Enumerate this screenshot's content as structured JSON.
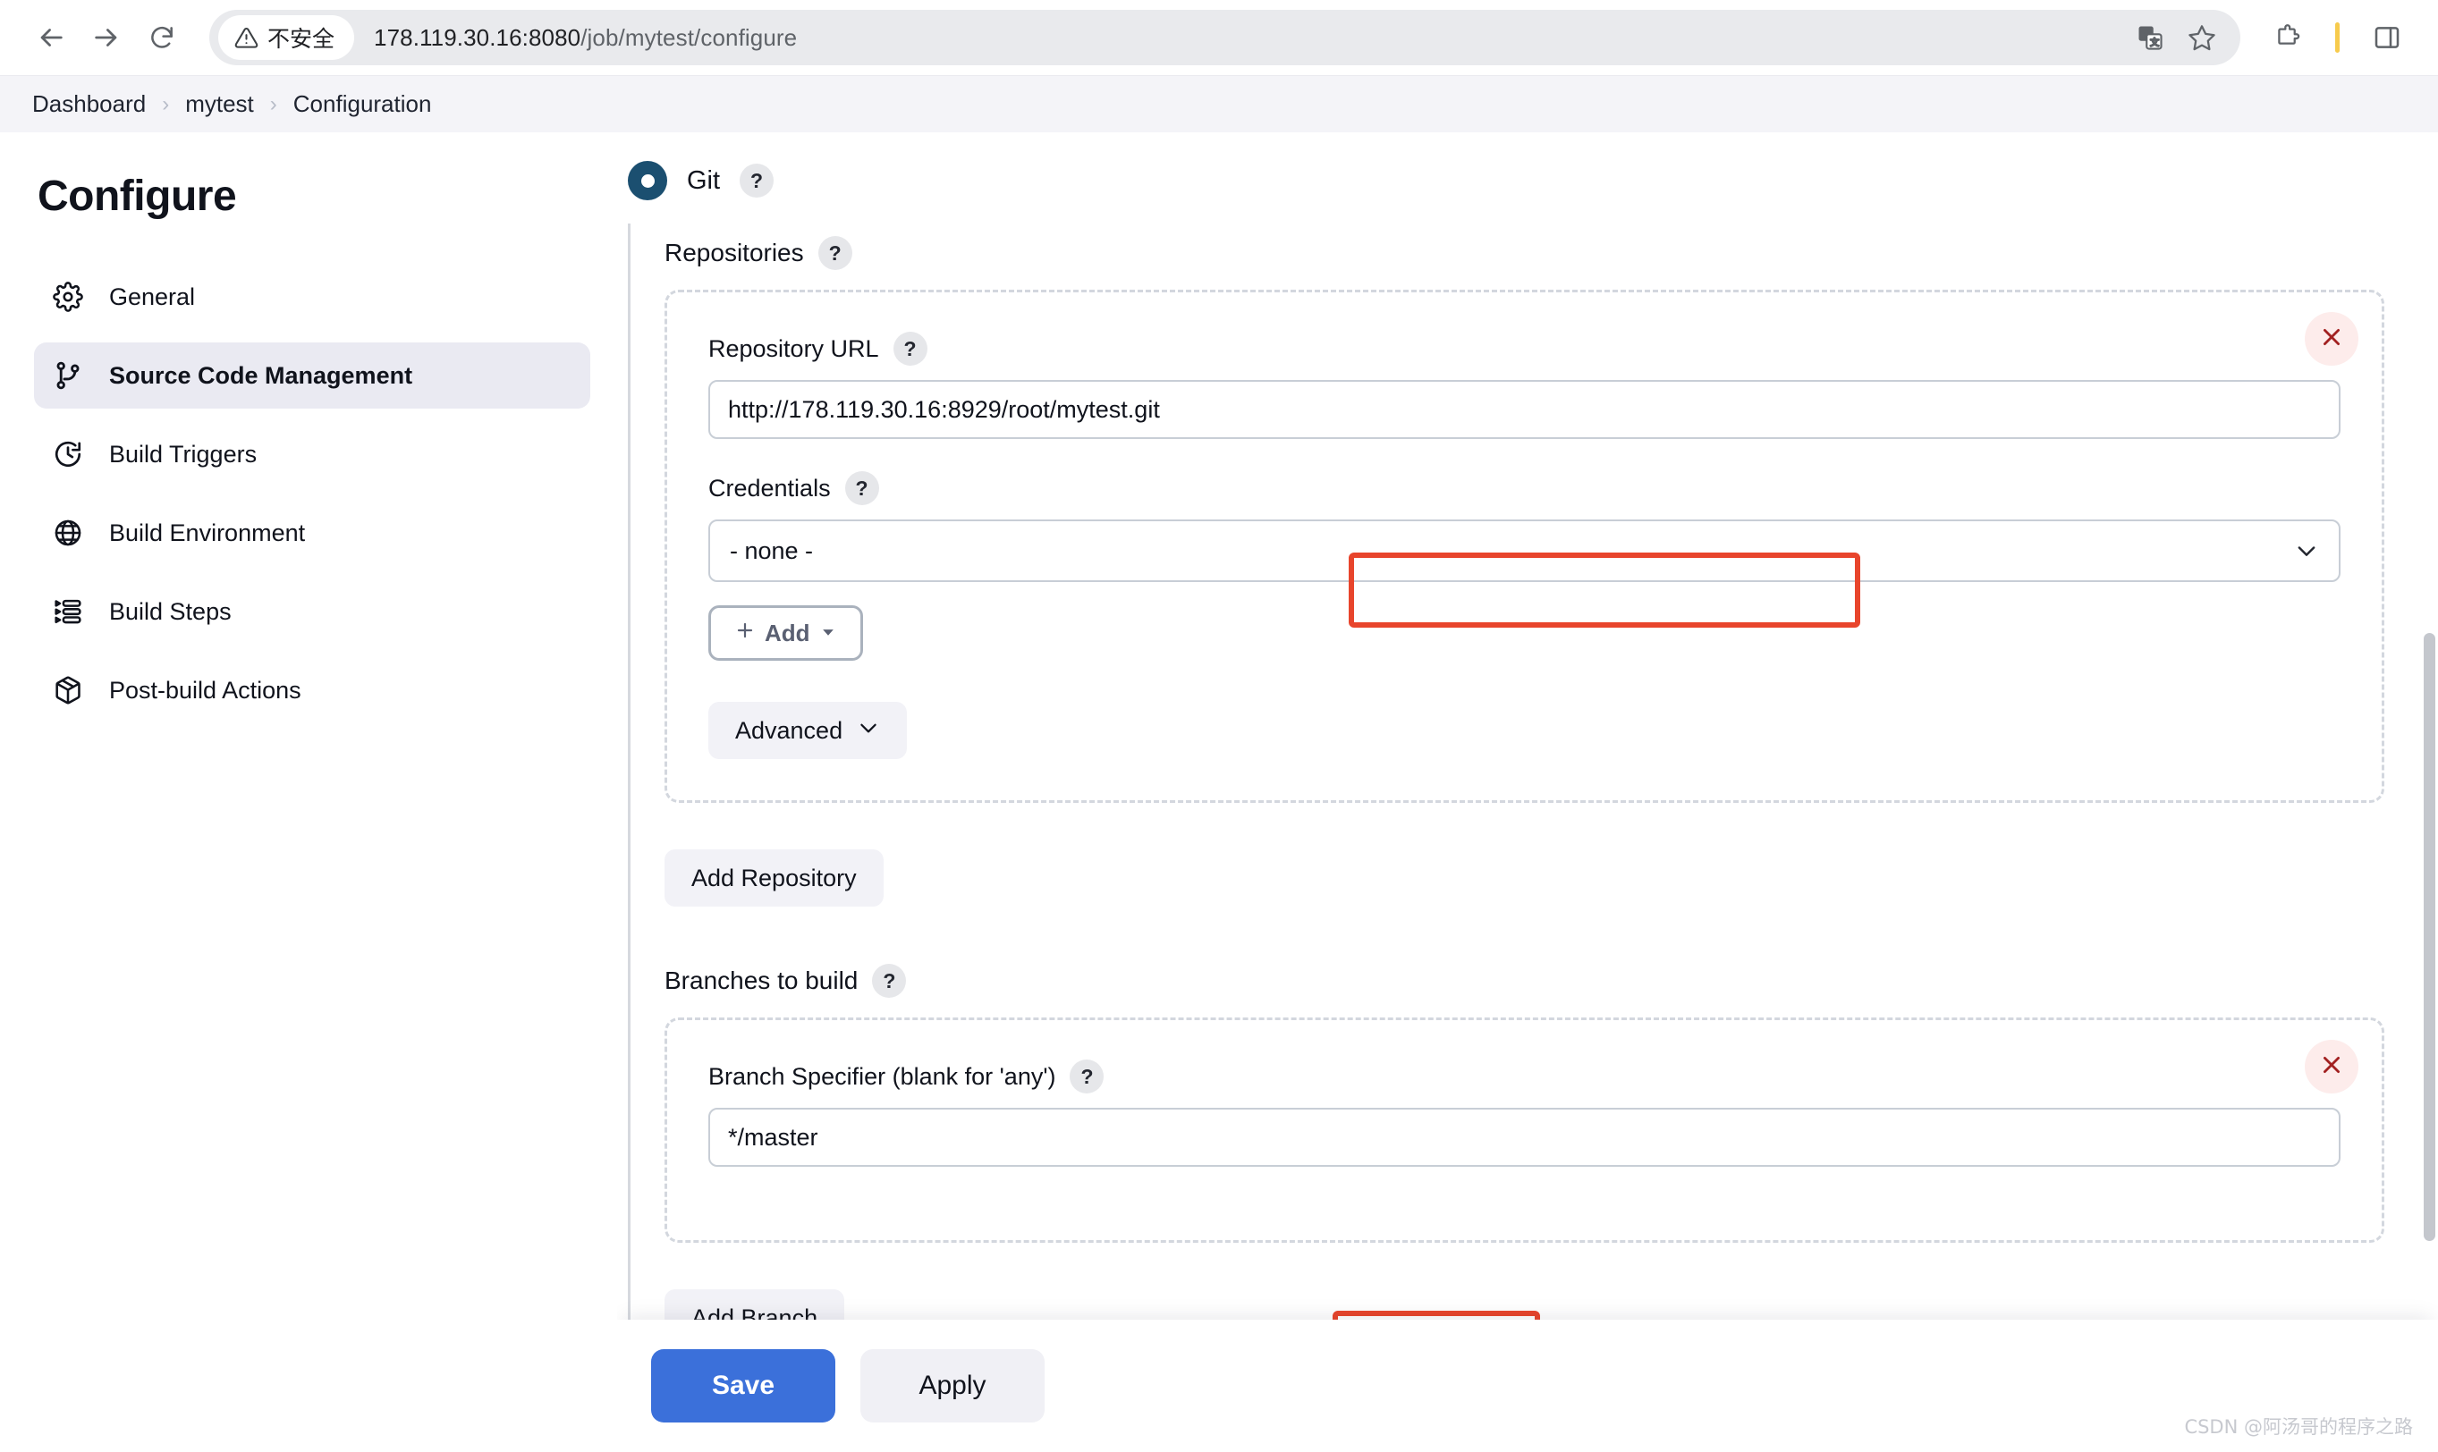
{
  "browser": {
    "back_icon": "arrow-left-icon",
    "forward_icon": "arrow-right-icon",
    "reload_icon": "reload-icon",
    "security_label": "不安全",
    "security_icon": "warning-triangle-icon",
    "url_host": "178.119.30.16:8080",
    "url_path": "/job/mytest/configure",
    "url_full": "178.119.30.16:8080/job/mytest/configure",
    "translate_icon": "translate-icon",
    "bookmark_icon": "star-icon",
    "extensions_icon": "puzzle-extensions-icon",
    "side_panel_icon": "side-panel-icon",
    "accent_yellow": "#f7cb4d"
  },
  "breadcrumb": {
    "items": [
      {
        "label": "Dashboard"
      },
      {
        "label": "mytest"
      },
      {
        "label": "Configuration"
      }
    ],
    "separator": "›"
  },
  "sidebar": {
    "title": "Configure",
    "items": [
      {
        "label": "General",
        "icon": "gear-icon",
        "active": false
      },
      {
        "label": "Source Code Management",
        "icon": "git-branch-icon",
        "active": true
      },
      {
        "label": "Build Triggers",
        "icon": "clock-icon",
        "active": false
      },
      {
        "label": "Build Environment",
        "icon": "globe-icon",
        "active": false
      },
      {
        "label": "Build Steps",
        "icon": "list-steps-icon",
        "active": false
      },
      {
        "label": "Post-build Actions",
        "icon": "package-box-icon",
        "active": false
      }
    ]
  },
  "main": {
    "scm_radio": {
      "label": "Git",
      "selected": true,
      "help": "?",
      "color": "#1b4f70"
    },
    "repositories": {
      "section_label": "Repositories",
      "section_help": "?",
      "delete_icon": "close-x-icon",
      "repository_url": {
        "label": "Repository URL",
        "help": "?",
        "value": "http://178.119.30.16:8929/root/mytest.git",
        "placeholder": ""
      },
      "credentials": {
        "label": "Credentials",
        "help": "?",
        "selected": "- none -",
        "chevron_icon": "chevron-down-icon",
        "options": [
          "- none -"
        ]
      },
      "add_credentials_button": {
        "label": "Add",
        "plus_icon": "plus-icon",
        "caret_icon": "caret-down-icon"
      },
      "advanced_button": {
        "label": "Advanced",
        "chevron_icon": "chevron-down-icon"
      },
      "add_repository_button": {
        "label": "Add Repository"
      }
    },
    "branches": {
      "section_label": "Branches to build",
      "section_help": "?",
      "delete_icon": "close-x-icon",
      "branch_specifier": {
        "label": "Branch Specifier (blank for 'any')",
        "help": "?",
        "value": "*/master",
        "placeholder": ""
      },
      "add_branch_button": {
        "label": "Add Branch"
      }
    },
    "footer": {
      "save_label": "Save",
      "apply_label": "Apply",
      "save_color": "#3b70da"
    },
    "annotations": {
      "color": "#e8452c",
      "boxes": [
        "repository-url-highlight",
        "branch-specifier-highlight"
      ]
    }
  },
  "watermark": {
    "text": "CSDN @阿汤哥的程序之路"
  }
}
